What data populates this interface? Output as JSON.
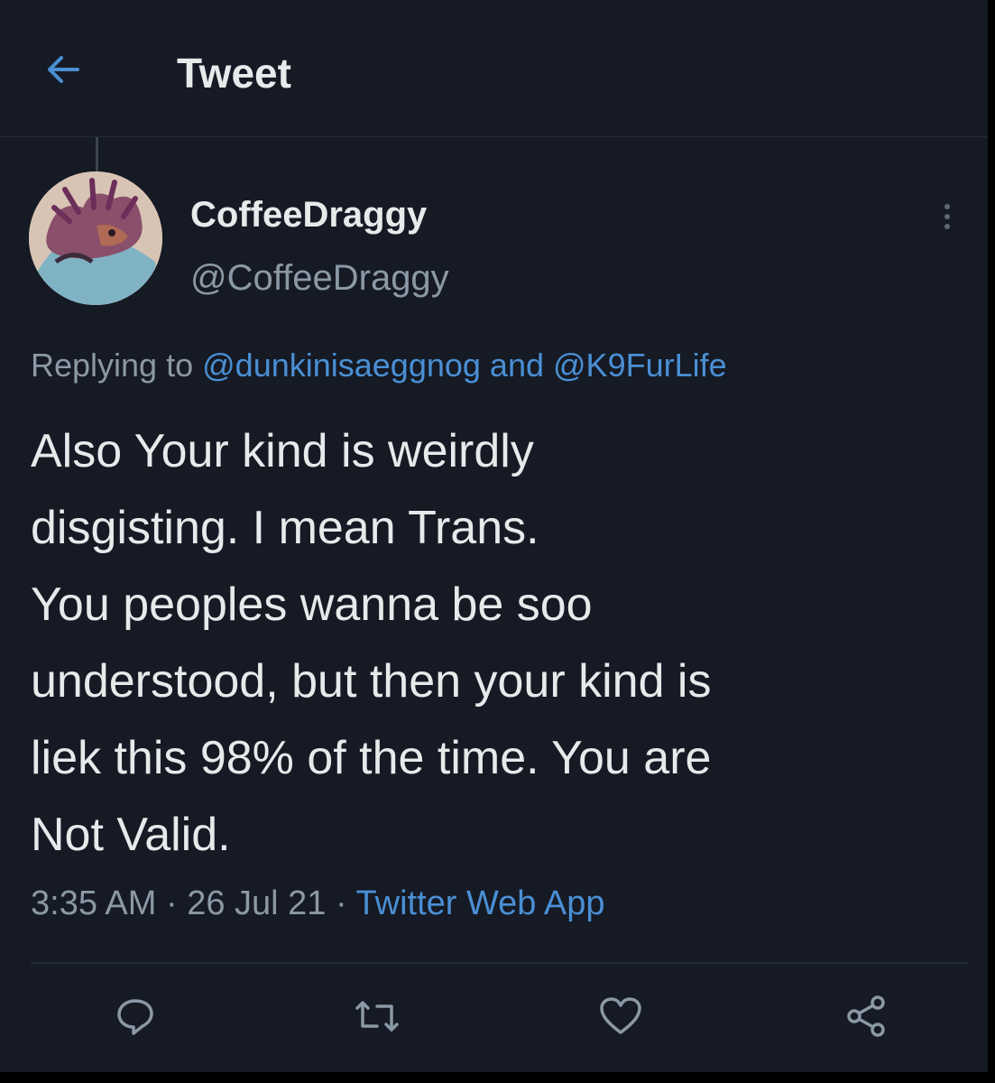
{
  "header": {
    "title": "Tweet",
    "back_icon": "arrow-left-icon"
  },
  "tweet": {
    "author": {
      "display_name": "CoffeeDraggy",
      "handle": "@CoffeeDraggy"
    },
    "replying_to": {
      "prefix": "Replying to",
      "mention1": "@dunkinisaeggnog",
      "conjunction": "and",
      "mention2": "@K9FurLife"
    },
    "text_lines": [
      "Also Your kind is weirdly",
      "disgisting. I mean Trans.",
      "You peoples wanna be soo",
      "understood, but then your kind is",
      "liek this 98% of the time. You are",
      "Not Valid."
    ],
    "time": "3:35 AM",
    "date": "26 Jul 21",
    "separator": "·",
    "source": "Twitter Web App"
  },
  "actions": [
    {
      "icon": "reply-icon"
    },
    {
      "icon": "retweet-icon"
    },
    {
      "icon": "like-icon"
    },
    {
      "icon": "share-icon"
    }
  ],
  "colors": {
    "background": "#151a24",
    "text": "#e7e9ea",
    "secondary_text": "#8b98a5",
    "accent": "#4a8fd4",
    "icon": "#8b98a5"
  }
}
